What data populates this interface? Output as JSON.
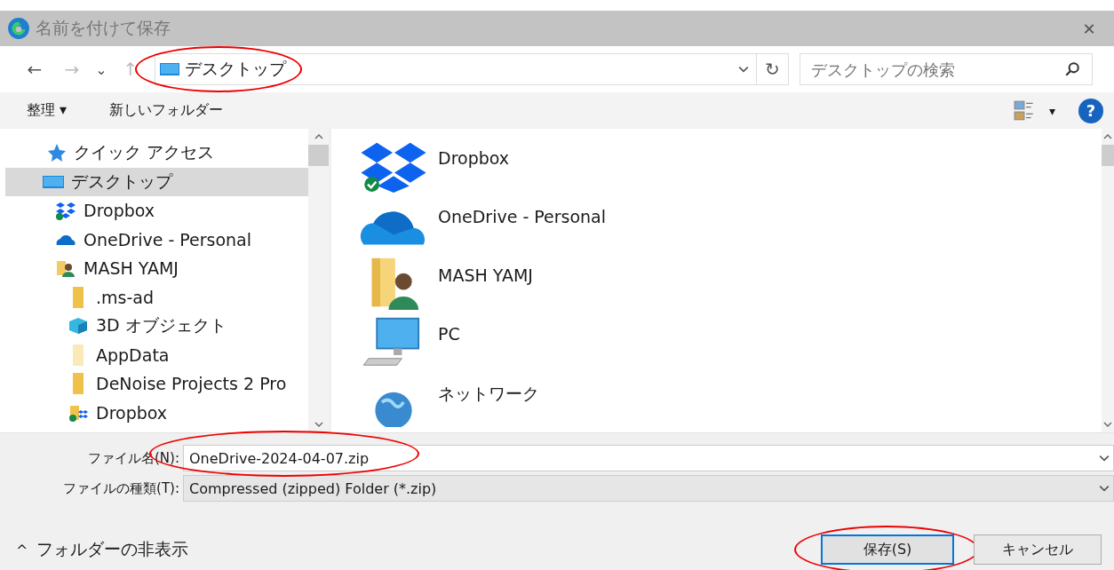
{
  "window": {
    "title": "名前を付けて保存",
    "close": "✕"
  },
  "nav": {
    "back": "←",
    "forward": "→",
    "recent": "⌄",
    "up": "↑"
  },
  "address": {
    "path": "デスクトップ",
    "circled": true,
    "refresh": "↻"
  },
  "search": {
    "placeholder": "デスクトップの検索"
  },
  "toolbar": {
    "organize": "整理 ▾",
    "new_folder": "新しいフォルダー",
    "view_caret": "▾",
    "help": "?"
  },
  "sidebar": {
    "items": [
      {
        "label": "クイック アクセス",
        "kind": "star",
        "selected": false
      },
      {
        "label": "デスクトップ",
        "kind": "desktop",
        "selected": true,
        "children": [
          {
            "label": "Dropbox",
            "kind": "dropbox",
            "selected": false
          },
          {
            "label": "OneDrive - Personal",
            "kind": "onedrive",
            "selected": false
          },
          {
            "label": "MASH YAMJ",
            "kind": "user-folder",
            "selected": false,
            "children": [
              {
                "label": ".ms-ad",
                "kind": "folder",
                "selected": false
              },
              {
                "label": "3D オブジェクト",
                "kind": "cube",
                "selected": false
              },
              {
                "label": "AppData",
                "kind": "folder-faded",
                "selected": false
              },
              {
                "label": "DeNoise Projects 2 Pro",
                "kind": "folder",
                "selected": false
              },
              {
                "label": "Dropbox",
                "kind": "dropbox-folder",
                "selected": false
              }
            ]
          }
        ]
      }
    ]
  },
  "content": {
    "items": [
      {
        "label": "Dropbox",
        "kind": "dropbox"
      },
      {
        "label": "OneDrive - Personal",
        "kind": "onedrive"
      },
      {
        "label": "MASH YAMJ",
        "kind": "user-folder"
      },
      {
        "label": "PC",
        "kind": "pc"
      },
      {
        "label": "ネットワーク",
        "kind": "network"
      }
    ]
  },
  "file_name": {
    "label": "ファイル名(N):",
    "value": "OneDrive-2024-04-07.zip",
    "circled": true
  },
  "file_type": {
    "label": "ファイルの種類(T):",
    "value": "Compressed (zipped) Folder (*.zip)"
  },
  "hide_folders": {
    "label": "フォルダーの非表示",
    "caret": "^"
  },
  "buttons": [
    {
      "label": "保存(S)",
      "kind": "primary",
      "circled": true
    },
    {
      "label": "キャンセル",
      "kind": "secondary",
      "circled": false
    }
  ]
}
